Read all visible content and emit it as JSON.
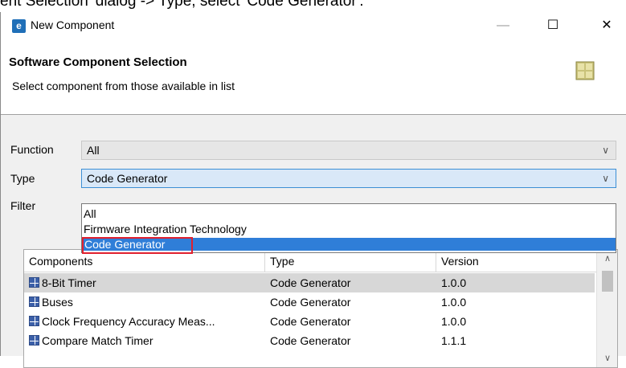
{
  "caption": "ent Selection' dialog -> Type, select 'Code Generator'.",
  "window": {
    "title": "New Component",
    "minimize": "—",
    "maximize": "☐",
    "close": "✕"
  },
  "header": {
    "title": "Software Component Selection",
    "subtitle": "Select component from those available in list"
  },
  "form": {
    "function_label": "Function",
    "function_value": "All",
    "type_label": "Type",
    "type_value": "Code Generator",
    "filter_label": "Filter"
  },
  "type_dropdown": {
    "options": [
      "All",
      "Firmware Integration Technology",
      "Code Generator"
    ],
    "selected": "Code Generator"
  },
  "table": {
    "columns": [
      "Components",
      "Type",
      "Version"
    ],
    "rows": [
      {
        "name": "8-Bit Timer",
        "type": "Code Generator",
        "version": "1.0.0"
      },
      {
        "name": "Buses",
        "type": "Code Generator",
        "version": "1.0.0"
      },
      {
        "name": "Clock Frequency Accuracy Meas...",
        "type": "Code Generator",
        "version": "1.0.0"
      },
      {
        "name": "Compare Match Timer",
        "type": "Code Generator",
        "version": "1.1.1"
      }
    ]
  },
  "colors": {
    "selection_blue": "#2f7ed8",
    "highlight_red": "#e0202e",
    "active_combo": "#d9e8f8"
  },
  "icons": {
    "app": "renesas-app-icon",
    "component": "grid-component-icon"
  }
}
